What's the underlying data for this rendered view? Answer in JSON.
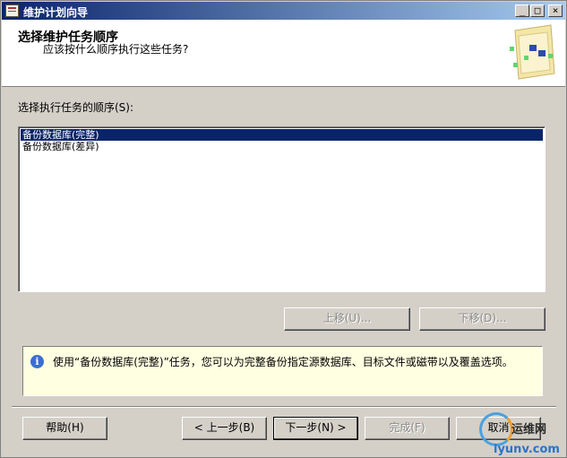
{
  "window": {
    "title": "维护计划向导",
    "controls": {
      "minimize": "_",
      "maximize": "□",
      "close": "×"
    }
  },
  "header": {
    "title": "选择维护任务顺序",
    "subtitle": "应该按什么顺序执行这些任务?"
  },
  "task_order": {
    "label": "选择执行任务的顺序(S):",
    "items": [
      {
        "label": "备份数据库(完整)",
        "selected": true
      },
      {
        "label": "备份数据库(差异)",
        "selected": false
      }
    ]
  },
  "move_buttons": {
    "up": "上移(U)...",
    "down": "下移(D)..."
  },
  "info": {
    "icon": "i",
    "text": "使用“备份数据库(完整)”任务，您可以为完整备份指定源数据库、目标文件或磁带以及覆盖选项。"
  },
  "footer": {
    "help": "帮助(H)",
    "back": "< 上一步(B)",
    "next": "下一步(N) >",
    "finish": "完成(F)",
    "cancel": "取消"
  },
  "watermark": {
    "brand": "运维网",
    "url": "iyunv.com"
  },
  "colors": {
    "title_bar_start": "#0a246a",
    "title_bar_end": "#a6caf0",
    "selection": "#0a246a",
    "info_background": "#ffffe1",
    "dialog_face": "#d4d0c8"
  }
}
